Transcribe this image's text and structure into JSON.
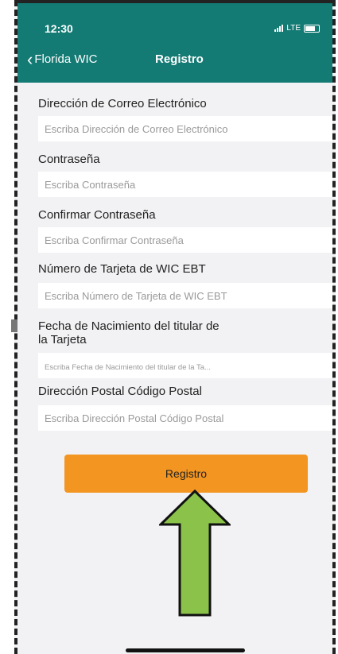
{
  "status_bar": {
    "time": "12:30",
    "carrier": "LTE"
  },
  "nav": {
    "back_label": "Florida WIC",
    "title": "Registro"
  },
  "form": {
    "fields": [
      {
        "label": "Dirección de Correo Electrónico",
        "placeholder": "Escriba Dirección de Correo Electrónico"
      },
      {
        "label": "Contraseña",
        "placeholder": "Escriba Contraseña"
      },
      {
        "label": "Confirmar Contraseña",
        "placeholder": "Escriba Confirmar Contraseña"
      },
      {
        "label": "Número de Tarjeta de WIC EBT",
        "placeholder": "Escriba Número de Tarjeta de WIC EBT"
      },
      {
        "label_line1": "Fecha de Nacimiento del titular de",
        "label_line2": "la Tarjeta",
        "placeholder": "Escriba Fecha de Nacimiento del titular de la Ta..."
      },
      {
        "label": "Dirección Postal Código Postal",
        "placeholder": "Escriba Dirección Postal Código Postal"
      }
    ]
  },
  "register_button": {
    "label": "Registro"
  },
  "colors": {
    "header": "#137a74",
    "button": "#f39521",
    "arrow": "#8bc34a",
    "background": "#f2f2f4"
  }
}
